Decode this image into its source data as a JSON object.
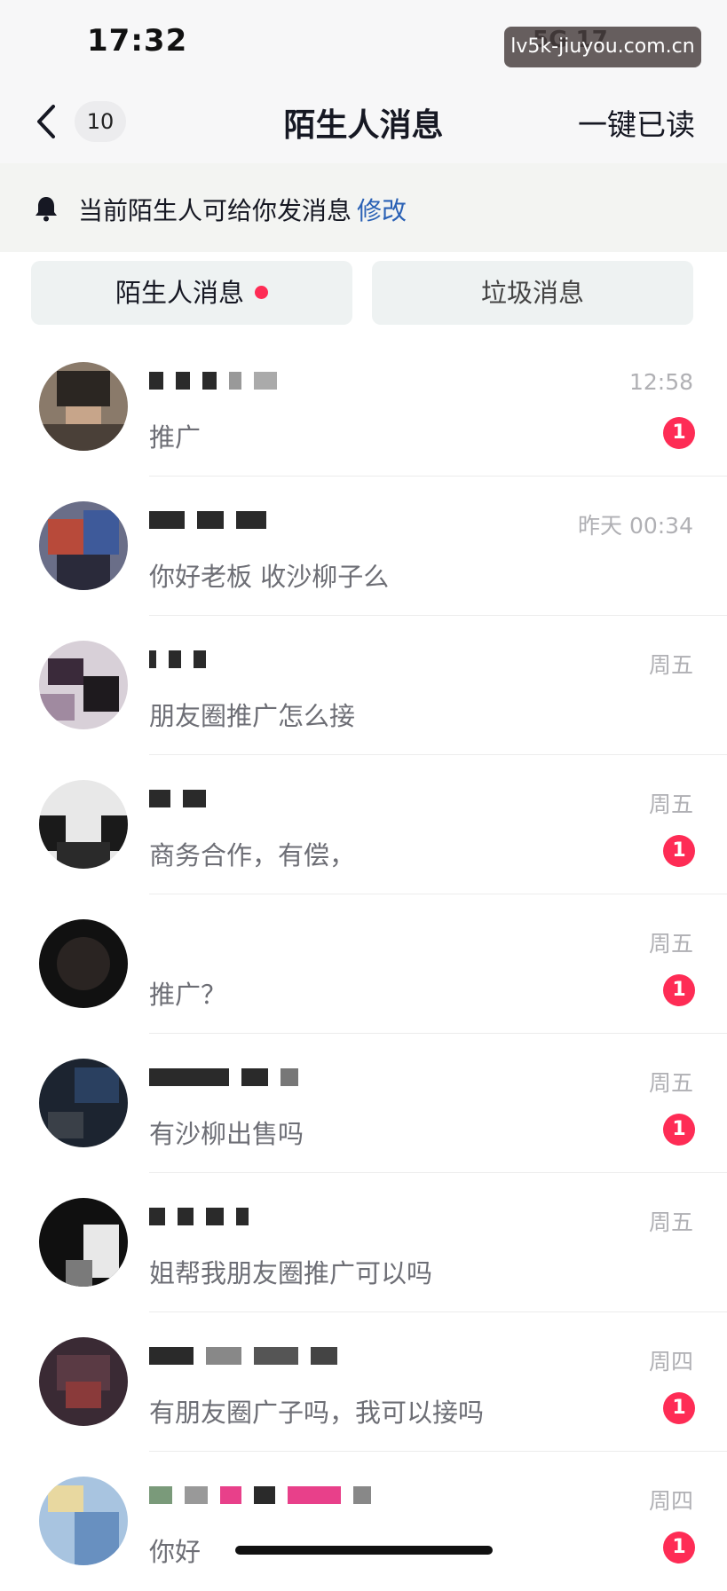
{
  "status_bar": {
    "time": "17:32",
    "network": "5G",
    "battery": "17"
  },
  "watermark": "lv5k-jiuyou.com.cn",
  "nav": {
    "unread_count": "10",
    "title": "陌生人消息",
    "mark_all_read": "一键已读"
  },
  "notice": {
    "text": "当前陌生人可给你发消息",
    "link": "修改"
  },
  "tabs": [
    {
      "label": "陌生人消息",
      "has_dot": true
    },
    {
      "label": "垃圾消息",
      "has_dot": false
    }
  ],
  "colors": {
    "accent": "#fe2c55",
    "link": "#2a61b5"
  },
  "messages": [
    {
      "name": "",
      "time": "12:58",
      "preview": "推广",
      "badge": "1"
    },
    {
      "name": "",
      "time": "昨天 00:34",
      "preview": "你好老板  收沙柳子么",
      "badge": ""
    },
    {
      "name": "",
      "time": "周五",
      "preview": "朋友圈推广怎么接",
      "badge": ""
    },
    {
      "name": "",
      "time": "周五",
      "preview": "商务合作，有偿，",
      "badge": "1"
    },
    {
      "name": "",
      "time": "周五",
      "preview": "推广？",
      "badge": "1"
    },
    {
      "name": "",
      "time": "周五",
      "preview": "有沙柳出售吗",
      "badge": "1"
    },
    {
      "name": "",
      "time": "周五",
      "preview": "姐帮我朋友圈推广可以吗",
      "badge": ""
    },
    {
      "name": "",
      "time": "周四",
      "preview": "有朋友圈广子吗，我可以接吗",
      "badge": "1"
    },
    {
      "name": "",
      "time": "周四",
      "preview": "你好",
      "badge": "1"
    }
  ]
}
